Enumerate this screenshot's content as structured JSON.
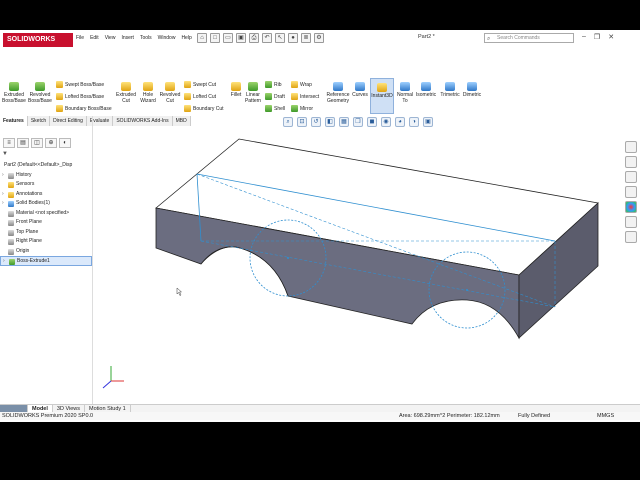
{
  "app": {
    "logo_text": "SOLIDWORKS",
    "doc_title": "Part2 *"
  },
  "menu": [
    "File",
    "Edit",
    "View",
    "Insert",
    "Tools",
    "Window",
    "Help"
  ],
  "search": {
    "placeholder": "Search Commands"
  },
  "ribbon": {
    "extruded_boss": "Extruded Boss/Base",
    "revolved_boss": "Revolved Boss/Base",
    "swept_boss": "Swept Boss/Base",
    "lofted_boss": "Lofted Boss/Base",
    "boundary_boss": "Boundary Boss/Base",
    "extruded_cut": "Extruded Cut",
    "hole_wizard": "Hole Wizard",
    "revolved_cut": "Revolved Cut",
    "swept_cut": "Swept Cut",
    "lofted_cut": "Lofted Cut",
    "boundary_cut": "Boundary Cut",
    "fillet": "Fillet",
    "linear_pattern": "Linear Pattern",
    "rib": "Rib",
    "draft": "Draft",
    "shell": "Shell",
    "wrap": "Wrap",
    "intersect": "Intersect",
    "mirror": "Mirror",
    "reference_geometry": "Reference Geometry",
    "curves": "Curves",
    "instant3d": "Instant3D",
    "normal_to": "Normal To",
    "isometric": "Isometric",
    "trimetric": "Trimetric",
    "dimetric": "Dimetric"
  },
  "tabs": [
    "Features",
    "Sketch",
    "Direct Editing",
    "Evaluate",
    "SOLIDWORKS Add-Ins",
    "MBD"
  ],
  "tree": {
    "root": "Part2  (Default<<Default>_Disp",
    "items": [
      "History",
      "Sensors",
      "Annotations",
      "Solid Bodies(1)",
      "Material <not specified>",
      "Front Plane",
      "Top Plane",
      "Right Plane",
      "Origin",
      "Boss-Extrude1"
    ]
  },
  "bottom_tabs": [
    "Model",
    "3D Views",
    "Motion Study 1"
  ],
  "status": {
    "version": "SOLIDWORKS Premium 2020 SP0.0",
    "measure": "Area: 698.29mm^2 Perimeter: 182.12mm",
    "state": "Fully Defined",
    "units": "MMGS"
  },
  "colors": {
    "brand": "#c8102e",
    "model_side": "#6b6d80",
    "sketch": "#2f8fd0"
  }
}
